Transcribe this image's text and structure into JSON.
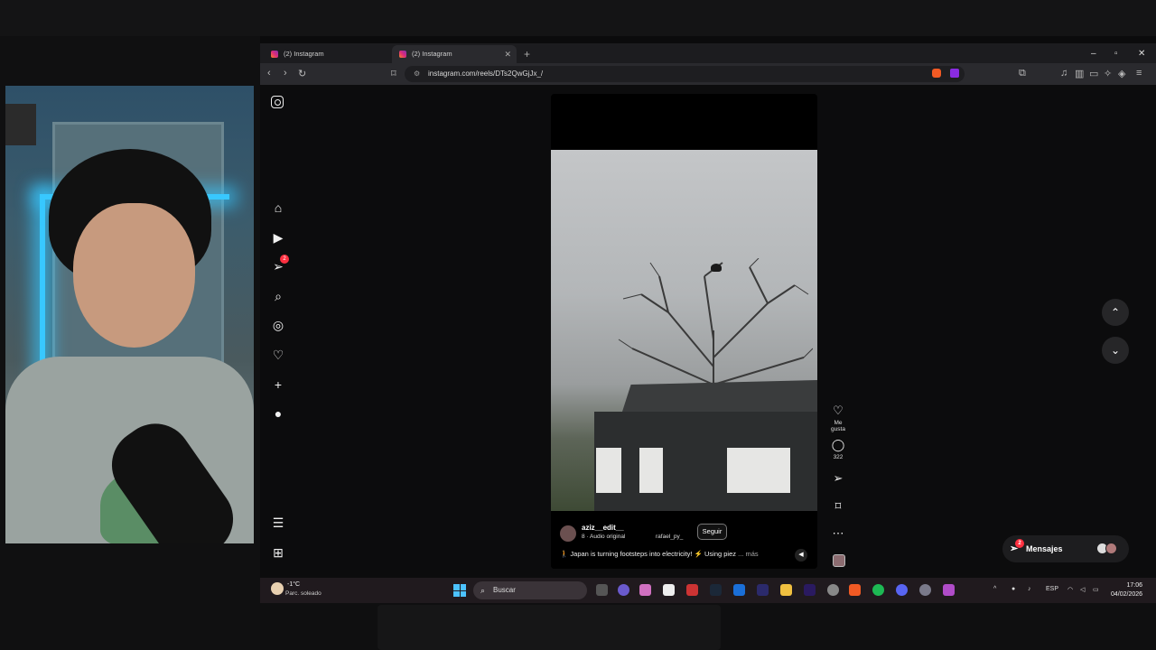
{
  "browser": {
    "tabs": [
      {
        "label": "(2) Instagram",
        "active": false
      },
      {
        "label": "(2) Instagram",
        "active": true
      }
    ],
    "new_tab_symbol": "+",
    "window_controls": [
      "–",
      "▫",
      "✕"
    ],
    "url": "instagram.com/reels/DTs2QwGjJx_/",
    "nav_icons": [
      "back-arrow-icon",
      "forward-arrow-icon",
      "reload-icon",
      "bookmark-icon"
    ]
  },
  "instagram": {
    "sidebar_icons": [
      "home-icon",
      "reels-icon",
      "messages-icon",
      "search-icon",
      "explore-icon",
      "notifications-icon",
      "create-icon",
      "profile-icon",
      "menu-icon",
      "apps-icon"
    ],
    "messages_badge": "2",
    "reel": {
      "username": "aziz__edit__",
      "audio": "8 · Audio original",
      "collaborator": "rafael_py_",
      "follow_label": "Seguir",
      "caption": "🚶 Japan is turning footsteps into electricity! ⚡ Using piez",
      "caption_more": "... más"
    },
    "actions": {
      "like_label": "Me gusta",
      "comments_count": "322"
    },
    "messages_pill": {
      "label": "Mensajes",
      "badge": "2"
    }
  },
  "taskbar": {
    "weather_temp": "-1°C",
    "weather_desc": "Parc. soleado",
    "search_placeholder": "Buscar",
    "language": "ESP",
    "time": "17:06",
    "date": "04/02/2026"
  },
  "colors": {
    "accent_badge": "#ff3040",
    "windows_blue": "#4cc2ff",
    "led_blue": "#38c8ff"
  }
}
